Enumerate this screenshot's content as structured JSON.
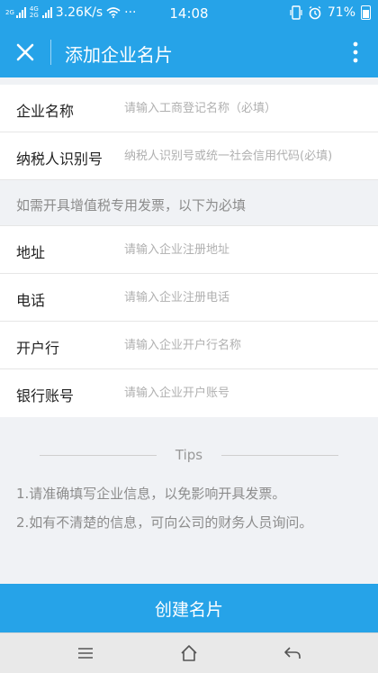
{
  "status_bar": {
    "network_label": "2G",
    "data_label_top": "4G",
    "data_label_bottom": "2G",
    "speed": "3.26K/s",
    "more": "···",
    "time": "14:08",
    "battery": "71%"
  },
  "header": {
    "title": "添加企业名片",
    "close_icon": "close-icon",
    "more_icon": "more-vertical-icon"
  },
  "form": {
    "company_name": {
      "label": "企业名称",
      "placeholder": "请输入工商登记名称（必填）",
      "value": ""
    },
    "tax_id": {
      "label": "纳税人识别号",
      "placeholder": "纳税人识别号或统一社会信用代码(必填)",
      "value": ""
    },
    "notice": "如需开具增值税专用发票，以下为必填",
    "address": {
      "label": "地址",
      "placeholder": "请输入企业注册地址",
      "value": ""
    },
    "phone": {
      "label": "电话",
      "placeholder": "请输入企业注册电话",
      "value": ""
    },
    "bank": {
      "label": "开户行",
      "placeholder": "请输入企业开户行名称",
      "value": ""
    },
    "account": {
      "label": "银行账号",
      "placeholder": "请输入企业开户账号",
      "value": ""
    }
  },
  "tips": {
    "title": "Tips",
    "items": [
      "1.请准确填写企业信息，以免影响开具发票。",
      "2.如有不清楚的信息，可向公司的财务人员询问。"
    ]
  },
  "actions": {
    "create_label": "创建名片"
  },
  "nav_bar": {
    "menu_icon": "menu-icon",
    "home_icon": "home-icon",
    "back_icon": "back-icon"
  },
  "colors": {
    "primary": "#26a3e8",
    "background": "#f0f2f5",
    "label": "#222222",
    "placeholder": "#b0b0b0",
    "hint": "#8c8c8c"
  }
}
